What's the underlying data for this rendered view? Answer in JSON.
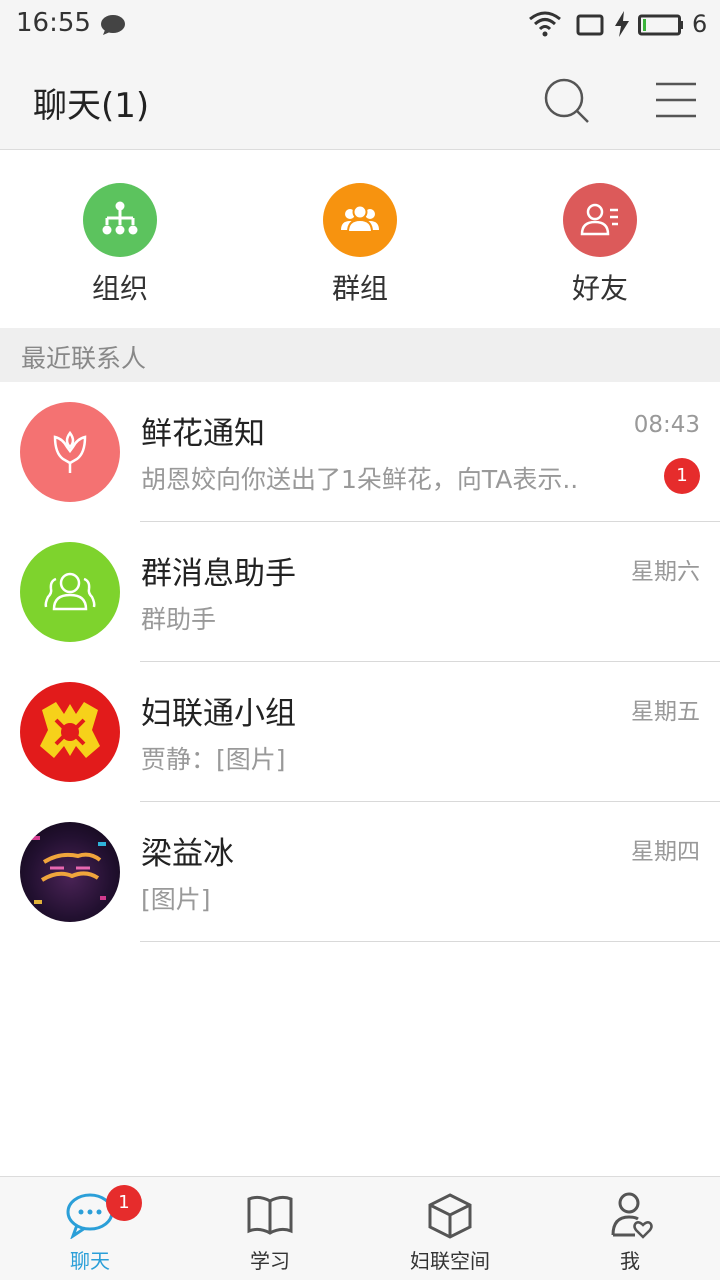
{
  "status_bar": {
    "time": "16:55",
    "battery_level": "6",
    "icons": [
      "message-icon",
      "wifi-icon",
      "sim-icon",
      "charging-icon",
      "battery-icon"
    ]
  },
  "header": {
    "title": "聊天(1)",
    "icons": [
      "search-icon",
      "menu-icon"
    ]
  },
  "quick_actions": [
    {
      "label": "组织",
      "icon": "org-tree-icon",
      "color": "#5cc35e"
    },
    {
      "label": "群组",
      "icon": "group-icon",
      "color": "#f7930f"
    },
    {
      "label": "好友",
      "icon": "friend-card-icon",
      "color": "#dc5a5a"
    }
  ],
  "section": {
    "label": "最近联系人"
  },
  "chats": [
    {
      "name": "鲜花通知",
      "time": "08:43",
      "preview": "胡恩姣向你送出了1朵鲜花，向TA表示..",
      "badge": "1",
      "avatar_icon": "flower-icon",
      "avatar_color": "#f47272"
    },
    {
      "name": "群消息助手",
      "time": "星期六",
      "preview": "群助手",
      "badge": "",
      "avatar_icon": "group-assistant-icon",
      "avatar_color": "#7ed32d"
    },
    {
      "name": "妇联通小组",
      "time": "星期五",
      "preview": "贾静：[图片]",
      "badge": "",
      "avatar_icon": "womens-federation-logo-icon",
      "avatar_color": "#e21b1b"
    },
    {
      "name": "梁益冰",
      "time": "星期四",
      "preview": "[图片]",
      "badge": "",
      "avatar_icon": "user-photo-icon",
      "avatar_color": "#1a1020"
    }
  ],
  "bottom_nav": [
    {
      "label": "聊天",
      "icon": "chat-bubble-icon",
      "active": true,
      "badge": "1"
    },
    {
      "label": "学习",
      "icon": "book-icon",
      "active": false,
      "badge": ""
    },
    {
      "label": "妇联空间",
      "icon": "cube-icon",
      "active": false,
      "badge": ""
    },
    {
      "label": "我",
      "icon": "profile-icon",
      "active": false,
      "badge": ""
    }
  ],
  "colors": {
    "accent": "#2b9fd8",
    "badge": "#e62c2c"
  }
}
